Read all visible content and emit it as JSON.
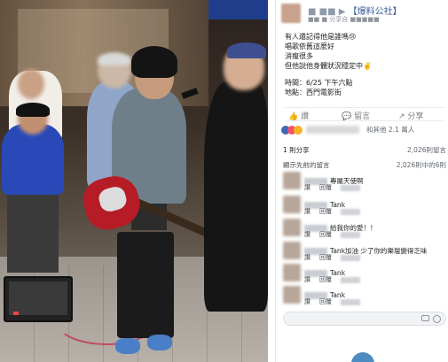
{
  "post": {
    "page_name": "【爆料公社】",
    "page_prefix": "■ ■■ ▶",
    "meta": "■■ ■ 分享自 ■■■■■",
    "lines": [
      "有人還記得他是誰嗎😢",
      "唱歌依舊這麼好",
      "消瘦很多",
      "但他說他身體狀況穩定中✌️"
    ],
    "time_label": "時間：6/25 下午六點",
    "place_label": "地點：西門電影街",
    "actions": [
      "讚",
      "留言",
      "分享"
    ],
    "reactions_text": "和其他 2.1 萬人",
    "shares_label": "1 則分享",
    "shares_count": "2,026則留言",
    "comments_heading": "顯示先前的留言",
    "comments_count": "2,026則中的6則",
    "comments": [
      {
        "text": "專屬天使啊",
        "links": [
          "讚",
          "回覆",
          "■■"
        ]
      },
      {
        "text": "Tank",
        "links": [
          "讚",
          "回覆",
          "■■"
        ]
      },
      {
        "text": "給我你的愛！！",
        "links": [
          "讚",
          "回覆",
          "■■"
        ]
      },
      {
        "text": "Tank加油 少了你的樂壇變得乏味",
        "links": [
          "讚",
          "回覆",
          "■■"
        ]
      },
      {
        "text": "Tank",
        "links": [
          "讚",
          "回覆",
          "■■"
        ]
      },
      {
        "text": "Tank",
        "links": [
          "讚",
          "回覆",
          "■■"
        ]
      }
    ]
  },
  "colors": {
    "link": "#385898",
    "like": "#4267b2",
    "love": "#f25268",
    "wow": "#f7b125"
  },
  "icons": [
    "like-icon",
    "comment-icon",
    "share-icon",
    "camera-icon",
    "emoji-icon"
  ]
}
